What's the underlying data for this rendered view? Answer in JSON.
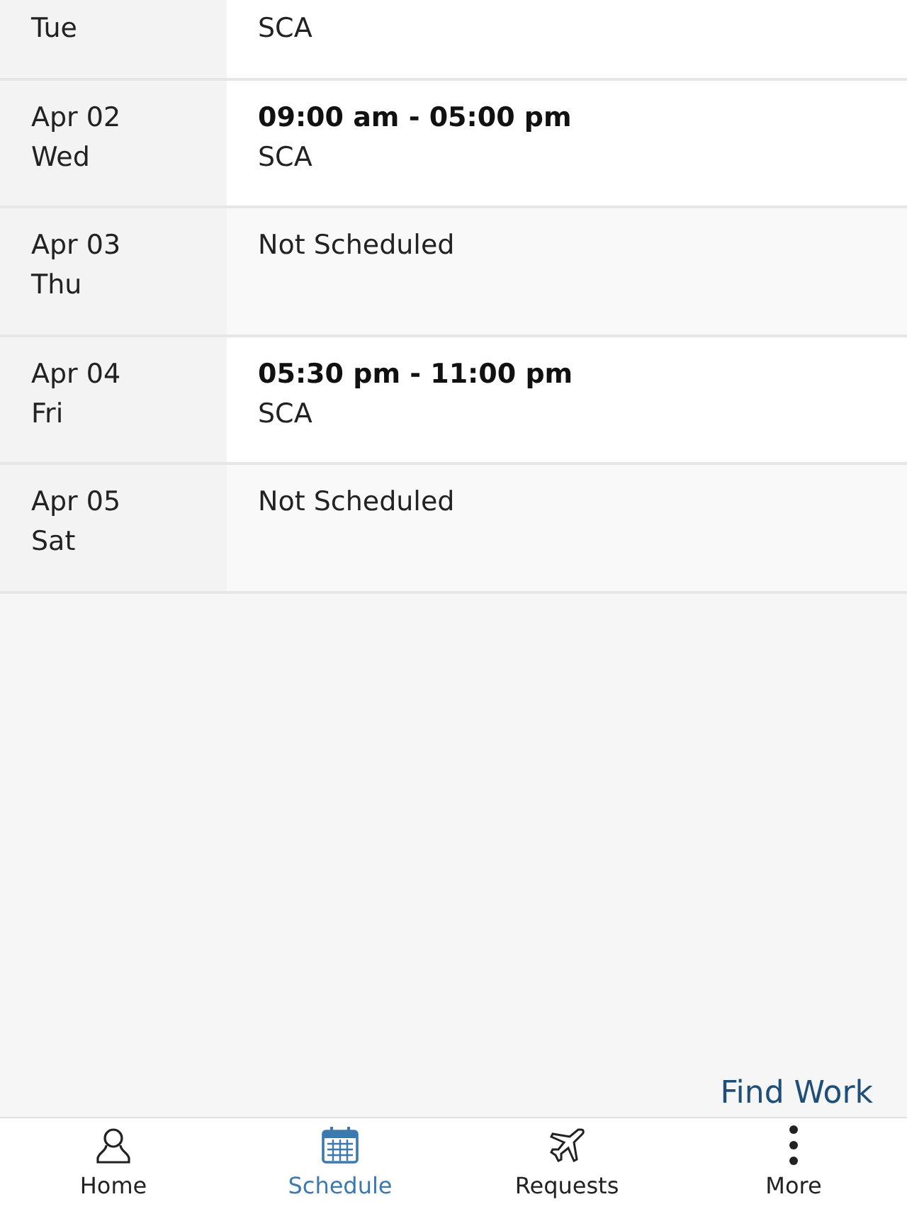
{
  "days": [
    {
      "weekday": "Tue",
      "kind": "shift",
      "location": "SCA"
    },
    {
      "date": "Apr 02",
      "weekday": "Wed",
      "kind": "shift",
      "time": "09:00 am - 05:00 pm",
      "location": "SCA"
    },
    {
      "date": "Apr 03",
      "weekday": "Thu",
      "kind": "off",
      "status": "Not Scheduled"
    },
    {
      "date": "Apr 04",
      "weekday": "Fri",
      "kind": "shift",
      "time": "05:30 pm - 11:00 pm",
      "location": "SCA"
    },
    {
      "date": "Apr 05",
      "weekday": "Sat",
      "kind": "off",
      "status": "Not Scheduled"
    }
  ],
  "find_work": "Find Work",
  "nav": [
    {
      "label": "Home",
      "kind": "person",
      "selected": false
    },
    {
      "label": "Schedule",
      "kind": "calendar",
      "selected": true
    },
    {
      "label": "Requests",
      "kind": "plane",
      "selected": false
    },
    {
      "label": "More",
      "kind": "dots",
      "selected": false
    }
  ]
}
